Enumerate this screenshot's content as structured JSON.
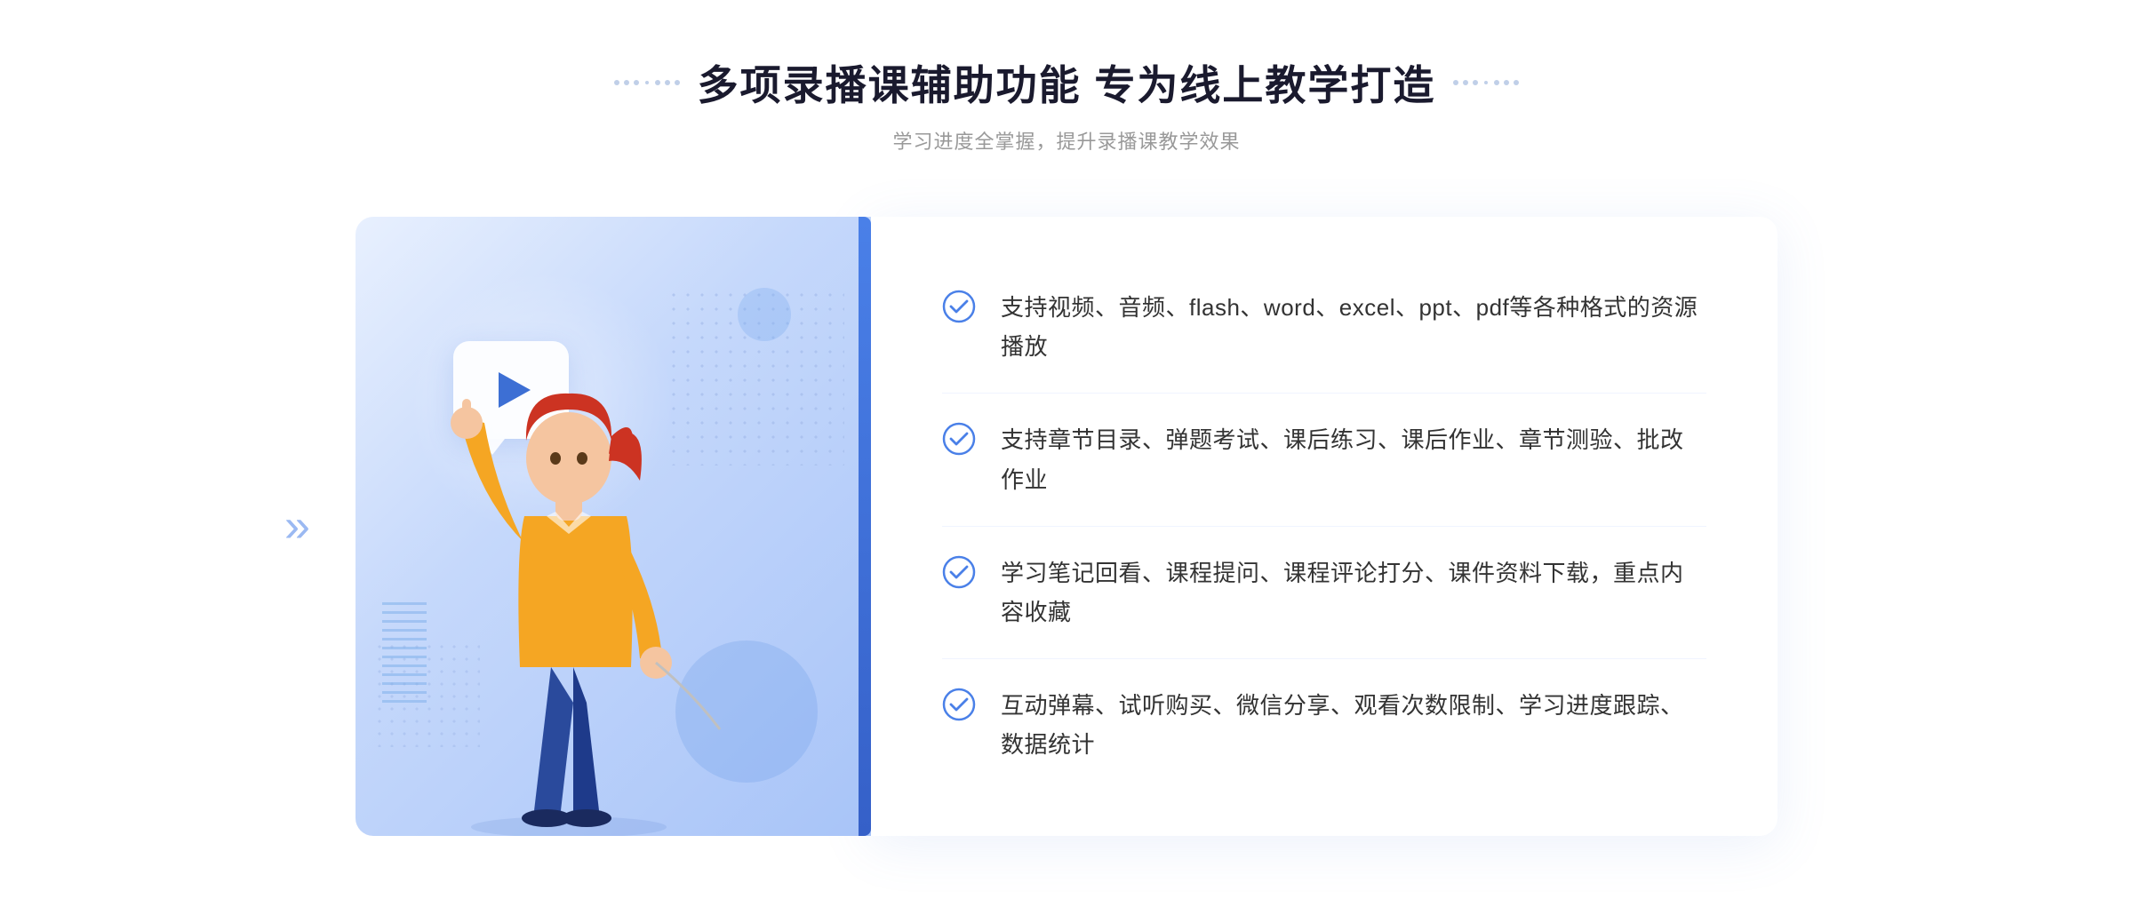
{
  "header": {
    "title": "多项录播课辅助功能 专为线上教学打造",
    "subtitle": "学习进度全掌握，提升录播课教学效果",
    "dots_left": [
      "•",
      "•",
      "•"
    ],
    "dots_right": [
      "•",
      "•",
      "•"
    ]
  },
  "features": [
    {
      "id": 1,
      "text": "支持视频、音频、flash、word、excel、ppt、pdf等各种格式的资源播放"
    },
    {
      "id": 2,
      "text": "支持章节目录、弹题考试、课后练习、课后作业、章节测验、批改作业"
    },
    {
      "id": 3,
      "text": "学习笔记回看、课程提问、课程评论打分、课件资料下载，重点内容收藏"
    },
    {
      "id": 4,
      "text": "互动弹幕、试听购买、微信分享、观看次数限制、学习进度跟踪、数据统计"
    }
  ],
  "colors": {
    "accent_blue": "#3d6fd4",
    "light_blue": "#a8c4f8",
    "check_color": "#4a80e8",
    "title_color": "#1a1a2e",
    "text_color": "#333333",
    "sub_color": "#999999"
  },
  "page": {
    "chevron_left": "»"
  }
}
